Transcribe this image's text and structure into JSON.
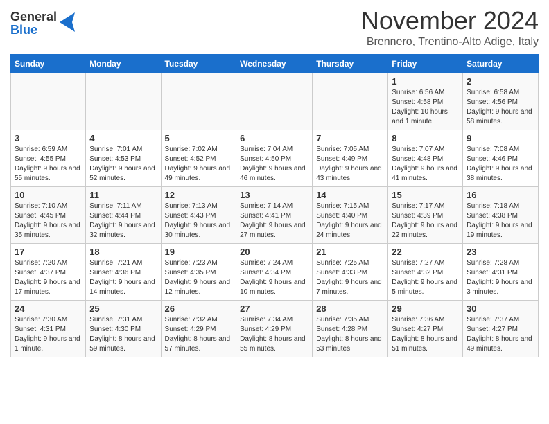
{
  "header": {
    "logo_general": "General",
    "logo_blue": "Blue",
    "month_title": "November 2024",
    "location": "Brennero, Trentino-Alto Adige, Italy"
  },
  "weekdays": [
    "Sunday",
    "Monday",
    "Tuesday",
    "Wednesday",
    "Thursday",
    "Friday",
    "Saturday"
  ],
  "weeks": [
    [
      {
        "day": "",
        "info": ""
      },
      {
        "day": "",
        "info": ""
      },
      {
        "day": "",
        "info": ""
      },
      {
        "day": "",
        "info": ""
      },
      {
        "day": "",
        "info": ""
      },
      {
        "day": "1",
        "info": "Sunrise: 6:56 AM\nSunset: 4:58 PM\nDaylight: 10 hours and 1 minute."
      },
      {
        "day": "2",
        "info": "Sunrise: 6:58 AM\nSunset: 4:56 PM\nDaylight: 9 hours and 58 minutes."
      }
    ],
    [
      {
        "day": "3",
        "info": "Sunrise: 6:59 AM\nSunset: 4:55 PM\nDaylight: 9 hours and 55 minutes."
      },
      {
        "day": "4",
        "info": "Sunrise: 7:01 AM\nSunset: 4:53 PM\nDaylight: 9 hours and 52 minutes."
      },
      {
        "day": "5",
        "info": "Sunrise: 7:02 AM\nSunset: 4:52 PM\nDaylight: 9 hours and 49 minutes."
      },
      {
        "day": "6",
        "info": "Sunrise: 7:04 AM\nSunset: 4:50 PM\nDaylight: 9 hours and 46 minutes."
      },
      {
        "day": "7",
        "info": "Sunrise: 7:05 AM\nSunset: 4:49 PM\nDaylight: 9 hours and 43 minutes."
      },
      {
        "day": "8",
        "info": "Sunrise: 7:07 AM\nSunset: 4:48 PM\nDaylight: 9 hours and 41 minutes."
      },
      {
        "day": "9",
        "info": "Sunrise: 7:08 AM\nSunset: 4:46 PM\nDaylight: 9 hours and 38 minutes."
      }
    ],
    [
      {
        "day": "10",
        "info": "Sunrise: 7:10 AM\nSunset: 4:45 PM\nDaylight: 9 hours and 35 minutes."
      },
      {
        "day": "11",
        "info": "Sunrise: 7:11 AM\nSunset: 4:44 PM\nDaylight: 9 hours and 32 minutes."
      },
      {
        "day": "12",
        "info": "Sunrise: 7:13 AM\nSunset: 4:43 PM\nDaylight: 9 hours and 30 minutes."
      },
      {
        "day": "13",
        "info": "Sunrise: 7:14 AM\nSunset: 4:41 PM\nDaylight: 9 hours and 27 minutes."
      },
      {
        "day": "14",
        "info": "Sunrise: 7:15 AM\nSunset: 4:40 PM\nDaylight: 9 hours and 24 minutes."
      },
      {
        "day": "15",
        "info": "Sunrise: 7:17 AM\nSunset: 4:39 PM\nDaylight: 9 hours and 22 minutes."
      },
      {
        "day": "16",
        "info": "Sunrise: 7:18 AM\nSunset: 4:38 PM\nDaylight: 9 hours and 19 minutes."
      }
    ],
    [
      {
        "day": "17",
        "info": "Sunrise: 7:20 AM\nSunset: 4:37 PM\nDaylight: 9 hours and 17 minutes."
      },
      {
        "day": "18",
        "info": "Sunrise: 7:21 AM\nSunset: 4:36 PM\nDaylight: 9 hours and 14 minutes."
      },
      {
        "day": "19",
        "info": "Sunrise: 7:23 AM\nSunset: 4:35 PM\nDaylight: 9 hours and 12 minutes."
      },
      {
        "day": "20",
        "info": "Sunrise: 7:24 AM\nSunset: 4:34 PM\nDaylight: 9 hours and 10 minutes."
      },
      {
        "day": "21",
        "info": "Sunrise: 7:25 AM\nSunset: 4:33 PM\nDaylight: 9 hours and 7 minutes."
      },
      {
        "day": "22",
        "info": "Sunrise: 7:27 AM\nSunset: 4:32 PM\nDaylight: 9 hours and 5 minutes."
      },
      {
        "day": "23",
        "info": "Sunrise: 7:28 AM\nSunset: 4:31 PM\nDaylight: 9 hours and 3 minutes."
      }
    ],
    [
      {
        "day": "24",
        "info": "Sunrise: 7:30 AM\nSunset: 4:31 PM\nDaylight: 9 hours and 1 minute."
      },
      {
        "day": "25",
        "info": "Sunrise: 7:31 AM\nSunset: 4:30 PM\nDaylight: 8 hours and 59 minutes."
      },
      {
        "day": "26",
        "info": "Sunrise: 7:32 AM\nSunset: 4:29 PM\nDaylight: 8 hours and 57 minutes."
      },
      {
        "day": "27",
        "info": "Sunrise: 7:34 AM\nSunset: 4:29 PM\nDaylight: 8 hours and 55 minutes."
      },
      {
        "day": "28",
        "info": "Sunrise: 7:35 AM\nSunset: 4:28 PM\nDaylight: 8 hours and 53 minutes."
      },
      {
        "day": "29",
        "info": "Sunrise: 7:36 AM\nSunset: 4:27 PM\nDaylight: 8 hours and 51 minutes."
      },
      {
        "day": "30",
        "info": "Sunrise: 7:37 AM\nSunset: 4:27 PM\nDaylight: 8 hours and 49 minutes."
      }
    ]
  ]
}
